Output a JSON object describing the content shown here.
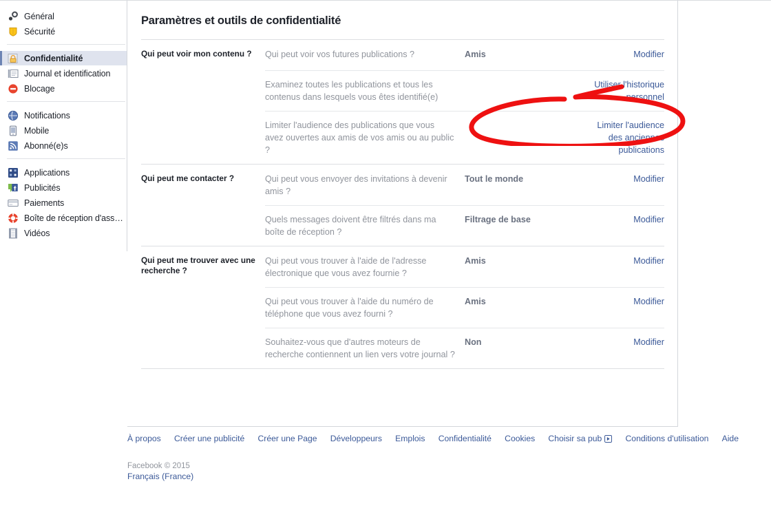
{
  "page": {
    "title": "Paramètres et outils de confidentialité"
  },
  "sidebar": {
    "groups": [
      {
        "items": [
          {
            "label": "Général",
            "icon": "gear-icon",
            "selected": false
          },
          {
            "label": "Sécurité",
            "icon": "shield-icon",
            "selected": false
          }
        ]
      },
      {
        "items": [
          {
            "label": "Confidentialité",
            "icon": "lock-icon",
            "selected": true
          },
          {
            "label": "Journal et identification",
            "icon": "timeline-icon",
            "selected": false
          },
          {
            "label": "Blocage",
            "icon": "block-icon",
            "selected": false
          }
        ]
      },
      {
        "items": [
          {
            "label": "Notifications",
            "icon": "globe-icon",
            "selected": false
          },
          {
            "label": "Mobile",
            "icon": "mobile-icon",
            "selected": false
          },
          {
            "label": "Abonné(e)s",
            "icon": "rss-icon",
            "selected": false
          }
        ]
      },
      {
        "items": [
          {
            "label": "Applications",
            "icon": "apps-icon",
            "selected": false
          },
          {
            "label": "Publicités",
            "icon": "ads-icon",
            "selected": false
          },
          {
            "label": "Paiements",
            "icon": "card-icon",
            "selected": false
          },
          {
            "label": "Boîte de réception d'ass…",
            "icon": "lifebuoy-icon",
            "selected": false
          },
          {
            "label": "Vidéos",
            "icon": "film-icon",
            "selected": false
          }
        ]
      }
    ]
  },
  "settings": {
    "sections": [
      {
        "heading": "Qui peut voir mon contenu ?",
        "rows": [
          {
            "question": "Qui peut voir vos futures publications ?",
            "value": "Amis",
            "action": "Modifier"
          },
          {
            "question": "Examinez toutes les publications et tous les contenus dans lesquels vous êtes identifié(e)",
            "value": "",
            "action": "Utiliser l'historique personnel"
          },
          {
            "question": "Limiter l'audience des publications que vous avez ouvertes aux amis de vos amis ou au public ?",
            "value": "",
            "action": "Limiter l'audience des anciennes publications"
          }
        ]
      },
      {
        "heading": "Qui peut me contacter ?",
        "rows": [
          {
            "question": "Qui peut vous envoyer des invitations à devenir amis ?",
            "value": "Tout le monde",
            "action": "Modifier"
          },
          {
            "question": "Quels messages doivent être filtrés dans ma boîte de réception ?",
            "value": "Filtrage de base",
            "action": "Modifier"
          }
        ]
      },
      {
        "heading": "Qui peut me trouver avec une recherche ?",
        "rows": [
          {
            "question": "Qui peut vous trouver à l'aide de l'adresse électronique que vous avez fournie ?",
            "value": "Amis",
            "action": "Modifier"
          },
          {
            "question": "Qui peut vous trouver à l'aide du numéro de téléphone que vous avez fourni ?",
            "value": "Amis",
            "action": "Modifier"
          },
          {
            "question": "Souhaitez-vous que d'autres moteurs de recherche contiennent un lien vers votre journal ?",
            "value": "Non",
            "action": "Modifier"
          }
        ]
      }
    ]
  },
  "footer": {
    "links": [
      {
        "label": "À propos",
        "icon": ""
      },
      {
        "label": "Créer une publicité",
        "icon": ""
      },
      {
        "label": "Créer une Page",
        "icon": ""
      },
      {
        "label": "Développeurs",
        "icon": ""
      },
      {
        "label": "Emplois",
        "icon": ""
      },
      {
        "label": "Confidentialité",
        "icon": ""
      },
      {
        "label": "Cookies",
        "icon": ""
      },
      {
        "label": "Choisir sa pub",
        "icon": "adchoices-icon"
      },
      {
        "label": "Conditions d'utilisation",
        "icon": ""
      },
      {
        "label": "Aide",
        "icon": ""
      }
    ],
    "copyright": "Facebook © 2015",
    "language": "Français (France)"
  },
  "annotation": {
    "shape": "hand-drawn-ellipse",
    "color": "#ee1111",
    "target": "Limiter l'audience des anciennes publications"
  },
  "colors": {
    "link": "#3b5998",
    "muted": "#90949c",
    "selected_bg": "#dfe3ee",
    "annotation_red": "#ee1111"
  }
}
